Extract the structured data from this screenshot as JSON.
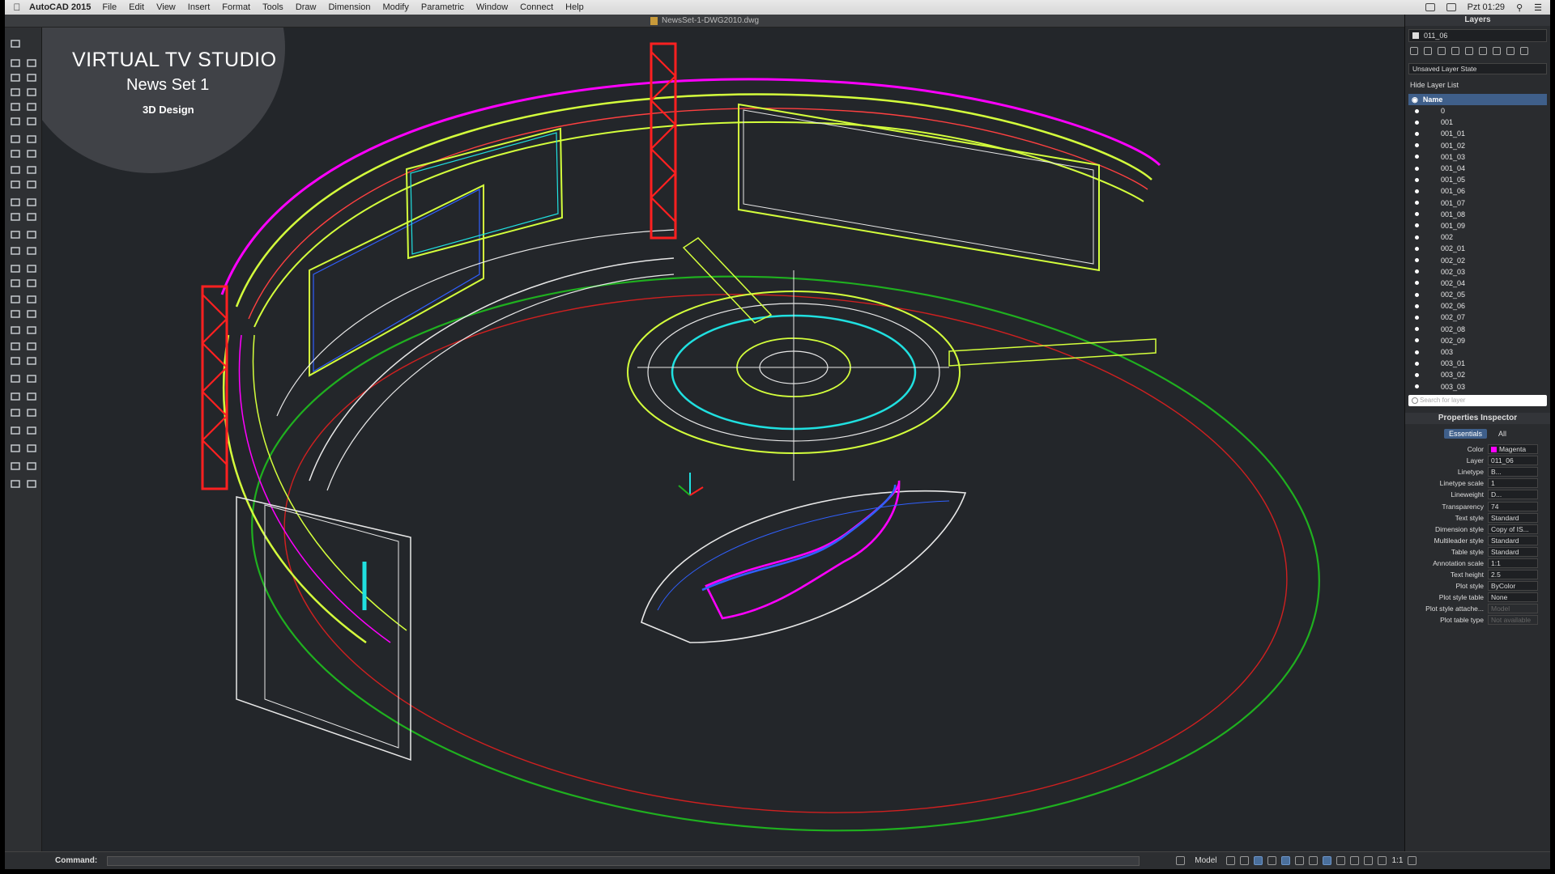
{
  "menubar": {
    "app_name": "AutoCAD 2015",
    "items": [
      "File",
      "Edit",
      "View",
      "Insert",
      "Format",
      "Tools",
      "Draw",
      "Dimension",
      "Modify",
      "Parametric",
      "Window",
      "Connect",
      "Help"
    ],
    "clock": "Pzt 01:29"
  },
  "document": {
    "title": "NewsSet-1-DWG2010.dwg"
  },
  "overlay": {
    "title": "VIRTUAL TV STUDIO",
    "subtitle": "News Set 1",
    "caption": "3D Design"
  },
  "command": {
    "label": "Command:"
  },
  "status": {
    "model_tab": "Model",
    "scale": "1:1"
  },
  "layers_panel": {
    "title": "Layers",
    "current_layer": "011_06",
    "layer_state": "Unsaved Layer State",
    "hide_list_label": "Hide Layer List",
    "column_name": "Name",
    "search_placeholder": "Search for layer",
    "layers": [
      "0",
      "001",
      "001_01",
      "001_02",
      "001_03",
      "001_04",
      "001_05",
      "001_06",
      "001_07",
      "001_08",
      "001_09",
      "002",
      "002_01",
      "002_02",
      "002_03",
      "002_04",
      "002_05",
      "002_06",
      "002_07",
      "002_08",
      "002_09",
      "003",
      "003_01",
      "003_02",
      "003_03"
    ]
  },
  "properties_panel": {
    "title": "Properties Inspector",
    "tabs": [
      "Essentials",
      "All"
    ],
    "rows": [
      {
        "label": "Color",
        "value": "Magenta"
      },
      {
        "label": "Layer",
        "value": "011_06"
      },
      {
        "label": "Linetype",
        "value": "B..."
      },
      {
        "label": "Linetype scale",
        "value": "1"
      },
      {
        "label": "Lineweight",
        "value": "D..."
      },
      {
        "label": "Transparency",
        "value": "74"
      },
      {
        "label": "Text style",
        "value": "Standard"
      },
      {
        "label": "Dimension style",
        "value": "Copy of IS..."
      },
      {
        "label": "Multileader style",
        "value": "Standard"
      },
      {
        "label": "Table style",
        "value": "Standard"
      },
      {
        "label": "Annotation scale",
        "value": "1:1"
      },
      {
        "label": "Text height",
        "value": "2.5"
      },
      {
        "label": "Plot style",
        "value": "ByColor"
      },
      {
        "label": "Plot style table",
        "value": "None"
      },
      {
        "label": "Plot style attache...",
        "value": "Model"
      },
      {
        "label": "Plot table type",
        "value": "Not available"
      }
    ]
  },
  "colors": {
    "canvas": "#23262a",
    "magenta": "#ff00ff",
    "yellow_green": "#d4ff3c",
    "red": "#ff2020",
    "green": "#1fb01f",
    "cyan": "#20e0e0",
    "white": "#e8e8e8",
    "blue": "#3060ff"
  },
  "icons": [
    "apple-icon",
    "search-icon",
    "gear-icon",
    "autocad-logo-icon"
  ]
}
